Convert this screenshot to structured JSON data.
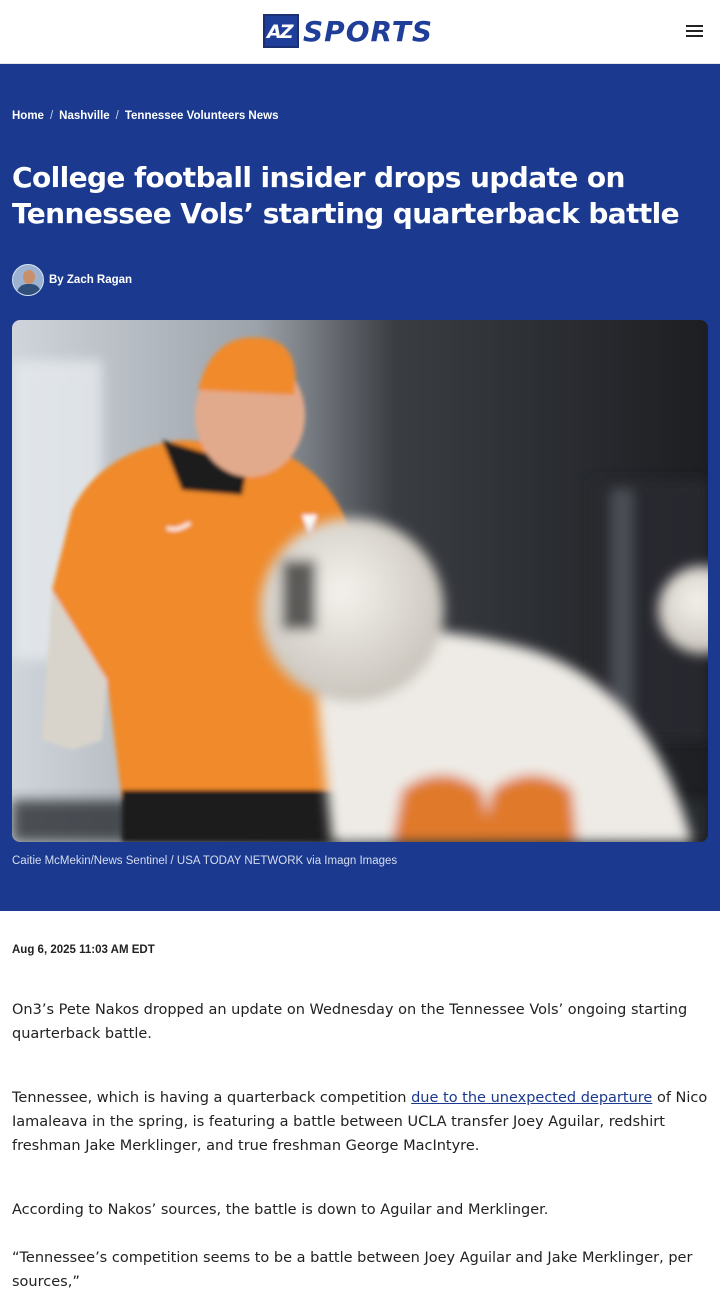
{
  "header": {
    "logo_mark": "AZ",
    "logo_word": "SPORTS",
    "menu_icon": "hamburger-menu-icon"
  },
  "breadcrumb": [
    {
      "label": "Home"
    },
    {
      "label": "Nashville"
    },
    {
      "label": "Tennessee Volunteers News"
    }
  ],
  "article": {
    "headline": "College football insider drops update on Tennessee Vols’ starting quarterback battle",
    "byline": "By Zach Ragan",
    "photo_caption": "Caitie McMekin/News Sentinel / USA TODAY NETWORK via Imagn Images",
    "date": "Aug 6, 2025 11:03 AM EDT",
    "p1": "On3’s Pete Nakos dropped an update on Wednesday on the Tennessee Vols’ ongoing starting quarterback battle.",
    "p2_before": "Tennessee, which is having a quarterback competition ",
    "p2_link": "due to the unexpected departure",
    "p2_after": " of Nico Iamaleava in the spring, is featuring a battle between UCLA transfer Joey Aguilar, redshirt freshman Jake Merklinger, and true freshman George MacIntyre.",
    "p3": "According to Nakos’ sources, the battle is down to Aguilar and Merklinger.",
    "p4": "“Tennessee’s competition seems to be a battle between Joey Aguilar and Jake Merklinger, per sources,”"
  },
  "colors": {
    "brand_blue": "#1b3a8f",
    "tennessee_orange": "#f08a2c"
  }
}
